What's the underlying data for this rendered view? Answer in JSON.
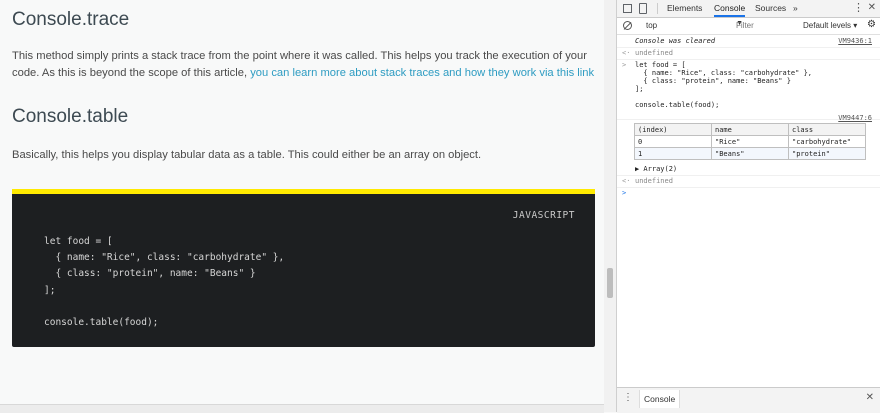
{
  "article": {
    "trace_heading": "Console.trace",
    "trace_paragraph": "This method simply prints a stack trace from the point where it was called. This helps you track the execution of your code. As this is beyond the scope of this article, ",
    "trace_link": "you can learn more about stack traces and how they work via this link",
    "table_heading": "Console.table",
    "table_paragraph": "Basically, this helps you display tabular data as a table. This could either be an array on object.",
    "code_language": "JAVASCRIPT",
    "code_lines": [
      "let food = [",
      "  { name: \"Rice\", class: \"carbohydrate\" },",
      "  { class: \"protein\", name: \"Beans\" }",
      "];",
      "",
      "console.table(food);"
    ]
  },
  "devtools": {
    "tabs": [
      "Elements",
      "Console",
      "Sources",
      "»"
    ],
    "active_tab": "Console",
    "context": "top",
    "filter_placeholder": "Filter",
    "levels": "Default levels ▾",
    "console": {
      "cleared": "Console was cleared",
      "cleared_src": "VM9436:1",
      "undefined_1": "undefined",
      "input_code": "let food = [\n  { name: \"Rice\", class: \"carbohydrate\" },\n  { class: \"protein\", name: \"Beans\" }\n];\n\nconsole.table(food);",
      "table_src": "VM9447:6",
      "table_columns": [
        "(index)",
        "name",
        "class"
      ],
      "table_rows": [
        [
          "0",
          "\"Rice\"",
          "\"carbohydrate\""
        ],
        [
          "1",
          "\"Beans\"",
          "\"protein\""
        ]
      ],
      "array_summary": "▶ Array(2)",
      "undefined_2": "undefined",
      "prompt": ">"
    },
    "drawer_tab": "Console",
    "gutter": {
      "result": "<·",
      "input": ">"
    }
  }
}
